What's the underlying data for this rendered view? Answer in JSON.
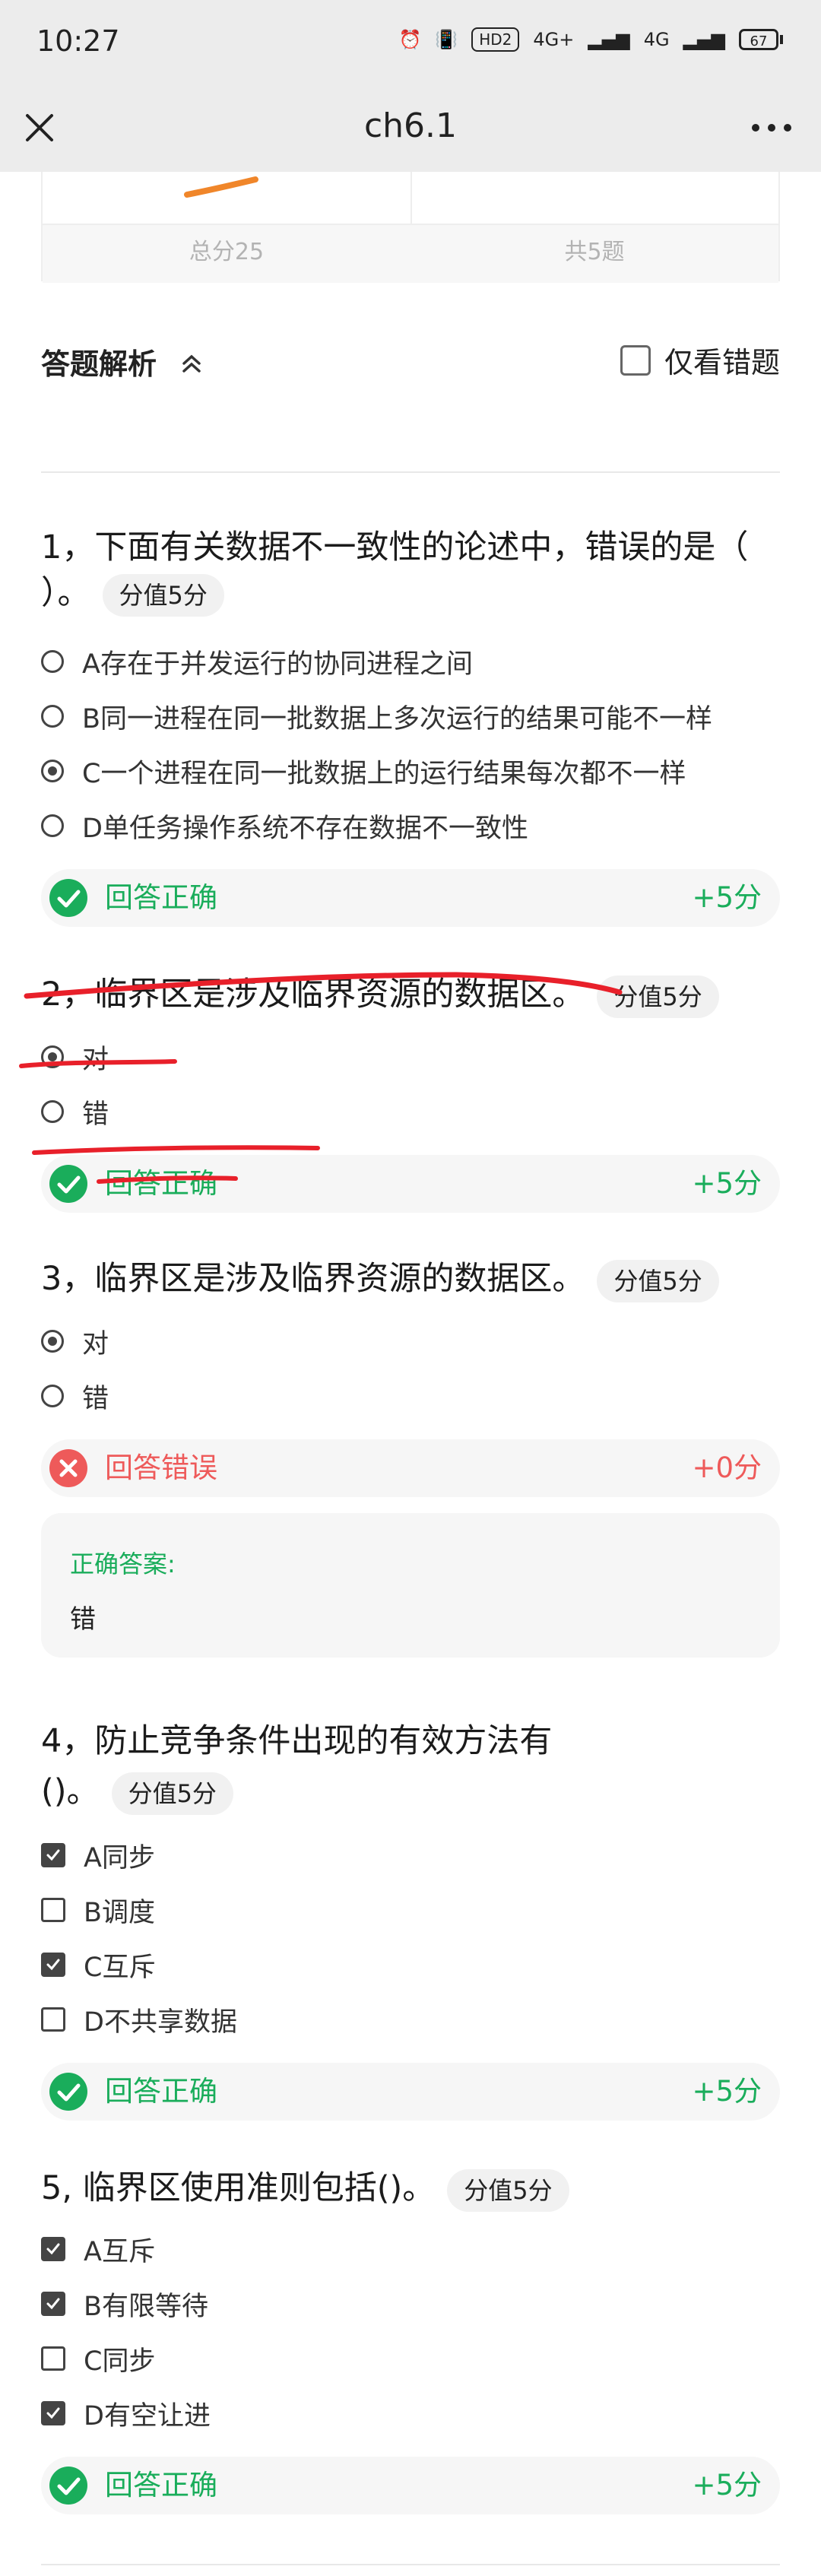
{
  "status_bar": {
    "time": "10:27",
    "net1": "4G+",
    "net2": "4G",
    "hd": "HD2",
    "battery": "67"
  },
  "app_bar": {
    "title": "ch6.1"
  },
  "summary": {
    "total_score": "总分25",
    "question_count": "共5题"
  },
  "section": {
    "title": "答题解析",
    "wrong_only_label": "仅看错题"
  },
  "questions": [
    {
      "title": "1，下面有关数据不一致性的论述中，错误的是（ ）。",
      "score": "分值5分",
      "options": [
        "A存在于并发运行的协同进程之间",
        "B同一进程在同一批数据上多次运行的结果可能不一样",
        "C一个进程在同一批数据上的运行结果每次都不一样",
        "D单任务操作系统不存在数据不一致性"
      ],
      "result": "回答正确",
      "points": "+5分"
    },
    {
      "title": "2，临界区是涉及临界资源的数据区。",
      "score": "分值5分",
      "options": [
        "对",
        "错"
      ],
      "result": "回答正确",
      "points": "+5分"
    },
    {
      "title": "3，临界区是涉及临界资源的数据区。",
      "score": "分值5分",
      "options": [
        "对",
        "错"
      ],
      "result": "回答错误",
      "points": "+0分",
      "correct_answer_label": "正确答案:",
      "correct_answer": "错"
    },
    {
      "title_line1": "4，防止竞争条件出现的有效方法有",
      "title_line2": "()。",
      "score": "分值5分",
      "options": [
        "A同步",
        "B调度",
        "C互斥",
        "D不共享数据"
      ],
      "result": "回答正确",
      "points": "+5分"
    },
    {
      "title": "5, 临界区使用准则包括()。",
      "score": "分值5分",
      "options": [
        "A互斥",
        "B有限等待",
        "C同步",
        "D有空让进"
      ],
      "result": "回答正确",
      "points": "+5分"
    }
  ],
  "colors": {
    "correct": "#1aad5b",
    "wrong": "#ee5a5a",
    "annotation_ink": "#e8202a"
  }
}
